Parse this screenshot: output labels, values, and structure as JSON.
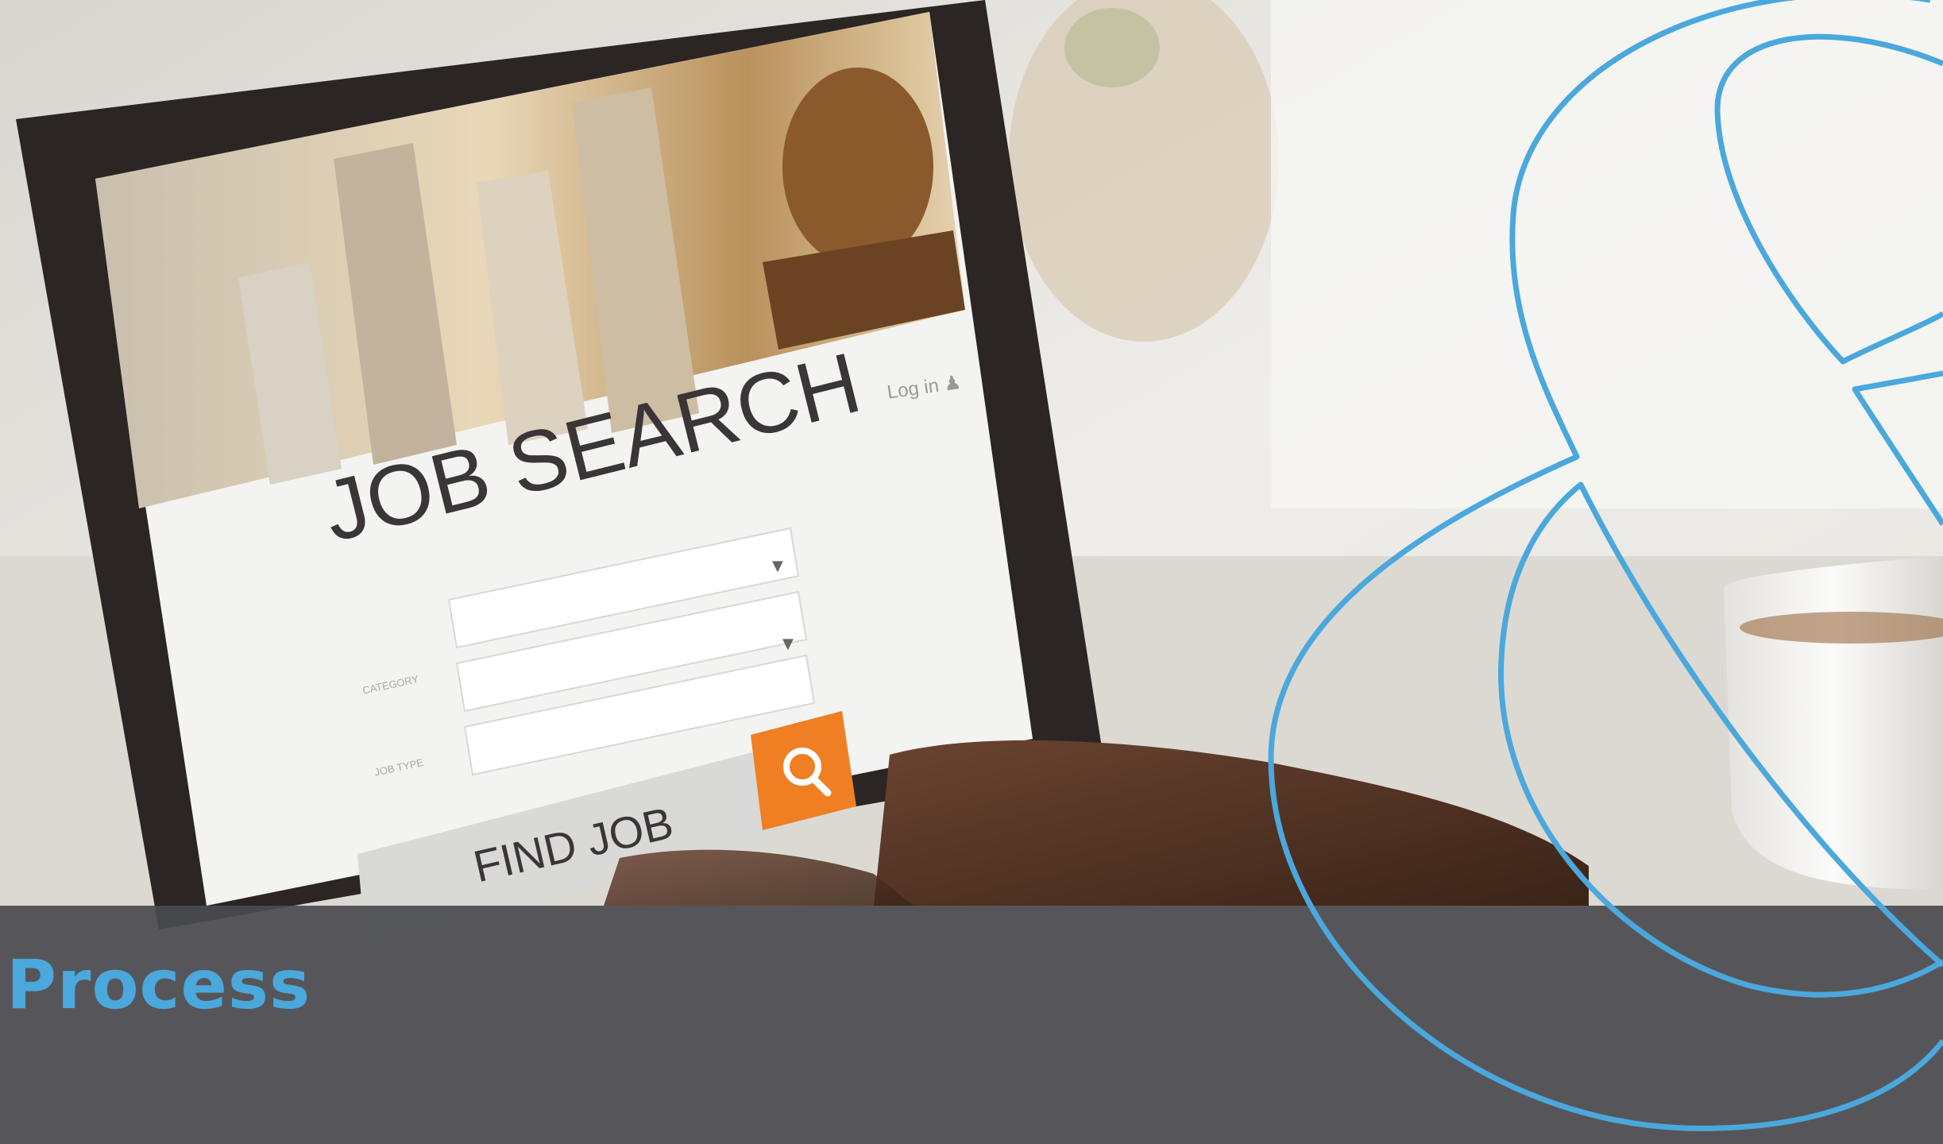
{
  "screen": {
    "heading": "JOB SEARCH",
    "login_link": "Log in",
    "category_label": "CATEGORY",
    "job_type_label": "JOB TYPE",
    "find_button": "FIND JOB"
  },
  "caption": {
    "title": "Process"
  },
  "colors": {
    "accent_blue": "#4aa8dd",
    "search_orange": "#ef7f22",
    "band_gray": "#4a4b4f"
  },
  "icons": {
    "search": "magnifier-icon",
    "user": "user-icon",
    "dropdown": "triangle-down-icon",
    "decoration": "ampersand-outline"
  }
}
